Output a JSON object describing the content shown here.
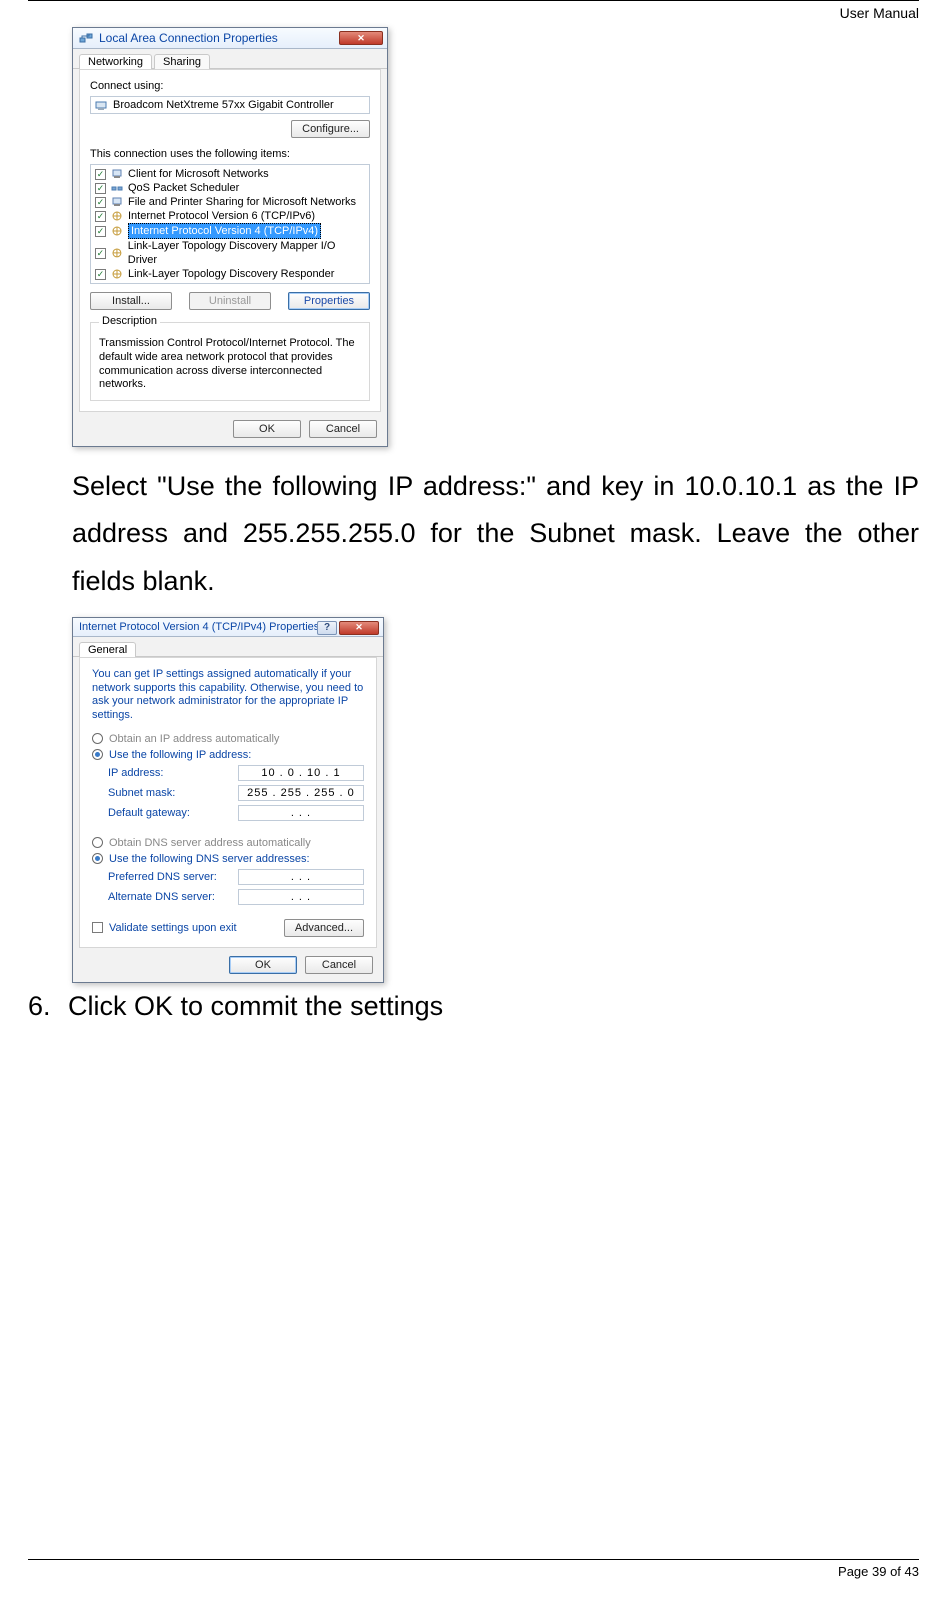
{
  "header": {
    "title": "User Manual"
  },
  "footer": {
    "page_info": "Page 39 of 43"
  },
  "dialog1": {
    "title": "Local Area Connection Properties",
    "tabs": {
      "networking": "Networking",
      "sharing": "Sharing"
    },
    "connect_using_label": "Connect using:",
    "adapter": "Broadcom NetXtreme 57xx Gigabit Controller",
    "configure_btn": "Configure...",
    "items_label": "This connection uses the following items:",
    "items": [
      "Client for Microsoft Networks",
      "QoS Packet Scheduler",
      "File and Printer Sharing for Microsoft Networks",
      "Internet Protocol Version 6 (TCP/IPv6)",
      "Internet Protocol Version 4 (TCP/IPv4)",
      "Link-Layer Topology Discovery Mapper I/O Driver",
      "Link-Layer Topology Discovery Responder"
    ],
    "install_btn": "Install...",
    "uninstall_btn": "Uninstall",
    "properties_btn": "Properties",
    "description_label": "Description",
    "description_text": "Transmission Control Protocol/Internet Protocol. The default wide area network protocol that provides communication across diverse interconnected networks.",
    "ok_btn": "OK",
    "cancel_btn": "Cancel"
  },
  "instruction1": "Select \"Use the following IP address:\" and key in 10.0.10.1 as the IP address and 255.255.255.0 for the Subnet mask. Leave the other fields blank.",
  "dialog2": {
    "title": "Internet Protocol Version 4 (TCP/IPv4) Properties",
    "tab_general": "General",
    "intro": "You can get IP settings assigned automatically if your network supports this capability. Otherwise, you need to ask your network administrator for the appropriate IP settings.",
    "radio_auto_ip": "Obtain an IP address automatically",
    "radio_manual_ip": "Use the following IP address:",
    "ip_label": "IP address:",
    "ip_value": "10   .   0    .  10   .   1",
    "subnet_label": "Subnet mask:",
    "subnet_value": "255 . 255 . 255 .   0",
    "gateway_label": "Default gateway:",
    "gateway_value": ".        .        .",
    "radio_auto_dns": "Obtain DNS server address automatically",
    "radio_manual_dns": "Use the following DNS server addresses:",
    "pref_dns_label": "Preferred DNS server:",
    "pref_dns_value": ".        .        .",
    "alt_dns_label": "Alternate DNS server:",
    "alt_dns_value": ".        .        .",
    "validate_label": "Validate settings upon exit",
    "advanced_btn": "Advanced...",
    "ok_btn": "OK",
    "cancel_btn": "Cancel"
  },
  "step6": {
    "num": "6.",
    "text": "Click OK to commit the settings"
  }
}
